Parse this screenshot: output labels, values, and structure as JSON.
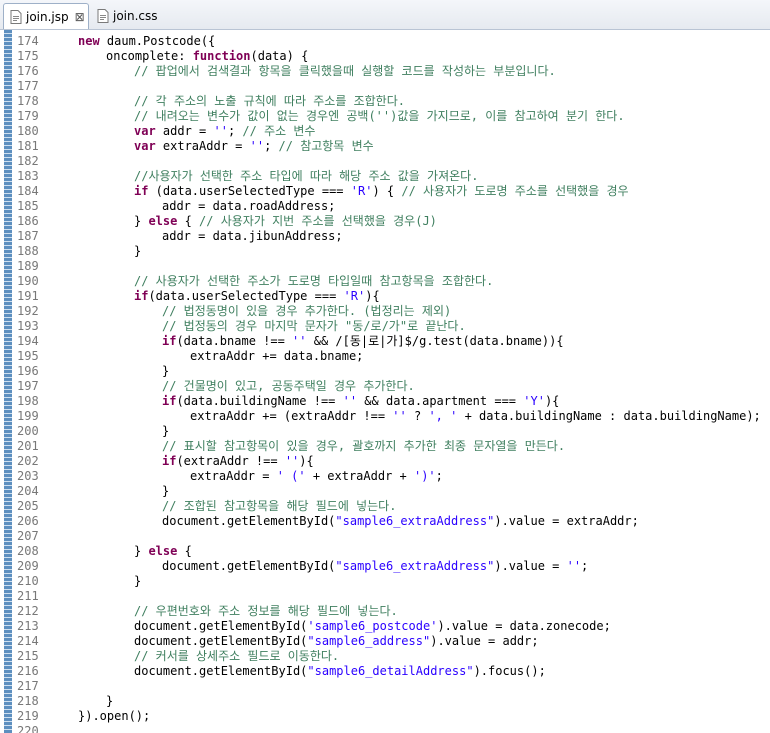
{
  "tabs": [
    {
      "label": "join.jsp",
      "active": true,
      "closable": true,
      "icon": "jsp-file-icon"
    },
    {
      "label": "join.css",
      "active": false,
      "closable": false,
      "icon": "css-file-icon"
    }
  ],
  "colors": {
    "keyword": "#7f0055",
    "comment": "#3f7f5f",
    "string": "#2a00ff",
    "plain": "#000000",
    "line_number": "#787878"
  },
  "lines": [
    {
      "n": "174",
      "indent": 0,
      "t": [
        [
          "k",
          "new"
        ],
        [
          "p",
          " daum.Postcode({"
        ]
      ]
    },
    {
      "n": "175",
      "indent": 1,
      "t": [
        [
          "p",
          "oncomplete: "
        ],
        [
          "k",
          "function"
        ],
        [
          "p",
          "(data) {"
        ]
      ]
    },
    {
      "n": "176",
      "indent": 2,
      "t": [
        [
          "c",
          "// 팝업에서 검색결과 항목을 클릭했을때 실행할 코드를 작성하는 부분입니다."
        ]
      ]
    },
    {
      "n": "177",
      "indent": 0,
      "t": []
    },
    {
      "n": "178",
      "indent": 2,
      "t": [
        [
          "c",
          "// 각 주소의 노출 규칙에 따라 주소를 조합한다."
        ]
      ]
    },
    {
      "n": "179",
      "indent": 2,
      "t": [
        [
          "c",
          "// 내려오는 변수가 값이 없는 경우엔 공백('')값을 가지므로, 이를 참고하여 분기 한다."
        ]
      ]
    },
    {
      "n": "180",
      "indent": 2,
      "t": [
        [
          "k",
          "var"
        ],
        [
          "p",
          " addr = "
        ],
        [
          "s",
          "''"
        ],
        [
          "p",
          "; "
        ],
        [
          "c",
          "// 주소 변수"
        ]
      ]
    },
    {
      "n": "181",
      "indent": 2,
      "t": [
        [
          "k",
          "var"
        ],
        [
          "p",
          " extraAddr = "
        ],
        [
          "s",
          "''"
        ],
        [
          "p",
          "; "
        ],
        [
          "c",
          "// 참고항목 변수"
        ]
      ]
    },
    {
      "n": "182",
      "indent": 0,
      "t": []
    },
    {
      "n": "183",
      "indent": 2,
      "t": [
        [
          "c",
          "//사용자가 선택한 주소 타입에 따라 해당 주소 값을 가져온다."
        ]
      ]
    },
    {
      "n": "184",
      "indent": 2,
      "t": [
        [
          "k",
          "if"
        ],
        [
          "p",
          " (data.userSelectedType === "
        ],
        [
          "s",
          "'R'"
        ],
        [
          "p",
          ") { "
        ],
        [
          "c",
          "// 사용자가 도로명 주소를 선택했을 경우"
        ]
      ]
    },
    {
      "n": "185",
      "indent": 3,
      "t": [
        [
          "p",
          "addr = data.roadAddress;"
        ]
      ]
    },
    {
      "n": "186",
      "indent": 2,
      "t": [
        [
          "p",
          "} "
        ],
        [
          "k",
          "else"
        ],
        [
          "p",
          " { "
        ],
        [
          "c",
          "// 사용자가 지번 주소를 선택했을 경우(J)"
        ]
      ]
    },
    {
      "n": "187",
      "indent": 3,
      "t": [
        [
          "p",
          "addr = data.jibunAddress;"
        ]
      ]
    },
    {
      "n": "188",
      "indent": 2,
      "t": [
        [
          "p",
          "}"
        ]
      ]
    },
    {
      "n": "189",
      "indent": 0,
      "t": []
    },
    {
      "n": "190",
      "indent": 2,
      "t": [
        [
          "c",
          "// 사용자가 선택한 주소가 도로명 타입일때 참고항목을 조합한다."
        ]
      ]
    },
    {
      "n": "191",
      "indent": 2,
      "t": [
        [
          "k",
          "if"
        ],
        [
          "p",
          "(data.userSelectedType === "
        ],
        [
          "s",
          "'R'"
        ],
        [
          "p",
          "){"
        ]
      ]
    },
    {
      "n": "192",
      "indent": 3,
      "t": [
        [
          "c",
          "// 법정동명이 있을 경우 추가한다. (법정리는 제외)"
        ]
      ]
    },
    {
      "n": "193",
      "indent": 3,
      "t": [
        [
          "c",
          "// 법정동의 경우 마지막 문자가 \"동/로/가\"로 끝난다."
        ]
      ]
    },
    {
      "n": "194",
      "indent": 3,
      "t": [
        [
          "k",
          "if"
        ],
        [
          "p",
          "(data.bname !== "
        ],
        [
          "s",
          "''"
        ],
        [
          "p",
          " && /[동|로|가]$/g.test(data.bname)){"
        ]
      ]
    },
    {
      "n": "195",
      "indent": 4,
      "t": [
        [
          "p",
          "extraAddr += data.bname;"
        ]
      ]
    },
    {
      "n": "196",
      "indent": 3,
      "t": [
        [
          "p",
          "}"
        ]
      ]
    },
    {
      "n": "197",
      "indent": 3,
      "t": [
        [
          "c",
          "// 건물명이 있고, 공동주택일 경우 추가한다."
        ]
      ]
    },
    {
      "n": "198",
      "indent": 3,
      "t": [
        [
          "k",
          "if"
        ],
        [
          "p",
          "(data.buildingName !== "
        ],
        [
          "s",
          "''"
        ],
        [
          "p",
          " && data.apartment === "
        ],
        [
          "s",
          "'Y'"
        ],
        [
          "p",
          "){"
        ]
      ]
    },
    {
      "n": "199",
      "indent": 4,
      "t": [
        [
          "p",
          "extraAddr += (extraAddr !== "
        ],
        [
          "s",
          "''"
        ],
        [
          "p",
          " ? "
        ],
        [
          "s",
          "', '"
        ],
        [
          "p",
          " + data.buildingName : data.buildingName);"
        ]
      ]
    },
    {
      "n": "200",
      "indent": 3,
      "t": [
        [
          "p",
          "}"
        ]
      ]
    },
    {
      "n": "201",
      "indent": 3,
      "t": [
        [
          "c",
          "// 표시할 참고항목이 있을 경우, 괄호까지 추가한 최종 문자열을 만든다."
        ]
      ]
    },
    {
      "n": "202",
      "indent": 3,
      "t": [
        [
          "k",
          "if"
        ],
        [
          "p",
          "(extraAddr !== "
        ],
        [
          "s",
          "''"
        ],
        [
          "p",
          "){"
        ]
      ]
    },
    {
      "n": "203",
      "indent": 4,
      "t": [
        [
          "p",
          "extraAddr = "
        ],
        [
          "s",
          "' ('"
        ],
        [
          "p",
          " + extraAddr + "
        ],
        [
          "s",
          "')'"
        ],
        [
          "p",
          ";"
        ]
      ]
    },
    {
      "n": "204",
      "indent": 3,
      "t": [
        [
          "p",
          "}"
        ]
      ]
    },
    {
      "n": "205",
      "indent": 3,
      "t": [
        [
          "c",
          "// 조합된 참고항목을 해당 필드에 넣는다."
        ]
      ]
    },
    {
      "n": "206",
      "indent": 3,
      "t": [
        [
          "p",
          "document.getElementById("
        ],
        [
          "s",
          "\"sample6_extraAddress\""
        ],
        [
          "p",
          ").value = extraAddr;"
        ]
      ]
    },
    {
      "n": "207",
      "indent": 0,
      "t": []
    },
    {
      "n": "208",
      "indent": 2,
      "t": [
        [
          "p",
          "} "
        ],
        [
          "k",
          "else"
        ],
        [
          "p",
          " {"
        ]
      ]
    },
    {
      "n": "209",
      "indent": 3,
      "t": [
        [
          "p",
          "document.getElementById("
        ],
        [
          "s",
          "\"sample6_extraAddress\""
        ],
        [
          "p",
          ").value = "
        ],
        [
          "s",
          "''"
        ],
        [
          "p",
          ";"
        ]
      ]
    },
    {
      "n": "210",
      "indent": 2,
      "t": [
        [
          "p",
          "}"
        ]
      ]
    },
    {
      "n": "211",
      "indent": 0,
      "t": []
    },
    {
      "n": "212",
      "indent": 2,
      "t": [
        [
          "c",
          "// 우편번호와 주소 정보를 해당 필드에 넣는다."
        ]
      ]
    },
    {
      "n": "213",
      "indent": 2,
      "t": [
        [
          "p",
          "document.getElementById("
        ],
        [
          "s",
          "'sample6_postcode'"
        ],
        [
          "p",
          ").value = data.zonecode;"
        ]
      ]
    },
    {
      "n": "214",
      "indent": 2,
      "t": [
        [
          "p",
          "document.getElementById("
        ],
        [
          "s",
          "\"sample6_address\""
        ],
        [
          "p",
          ").value = addr;"
        ]
      ]
    },
    {
      "n": "215",
      "indent": 2,
      "t": [
        [
          "c",
          "// 커서를 상세주소 필드로 이동한다."
        ]
      ]
    },
    {
      "n": "216",
      "indent": 2,
      "t": [
        [
          "p",
          "document.getElementById("
        ],
        [
          "s",
          "\"sample6_detailAddress\""
        ],
        [
          "p",
          ").focus();"
        ]
      ]
    },
    {
      "n": "217",
      "indent": 0,
      "t": []
    },
    {
      "n": "218",
      "indent": 1,
      "t": [
        [
          "p",
          "}"
        ]
      ]
    },
    {
      "n": "219",
      "indent": 0,
      "t": [
        [
          "p",
          "}).open();"
        ]
      ]
    },
    {
      "n": "220",
      "indent": 0,
      "t": []
    }
  ]
}
